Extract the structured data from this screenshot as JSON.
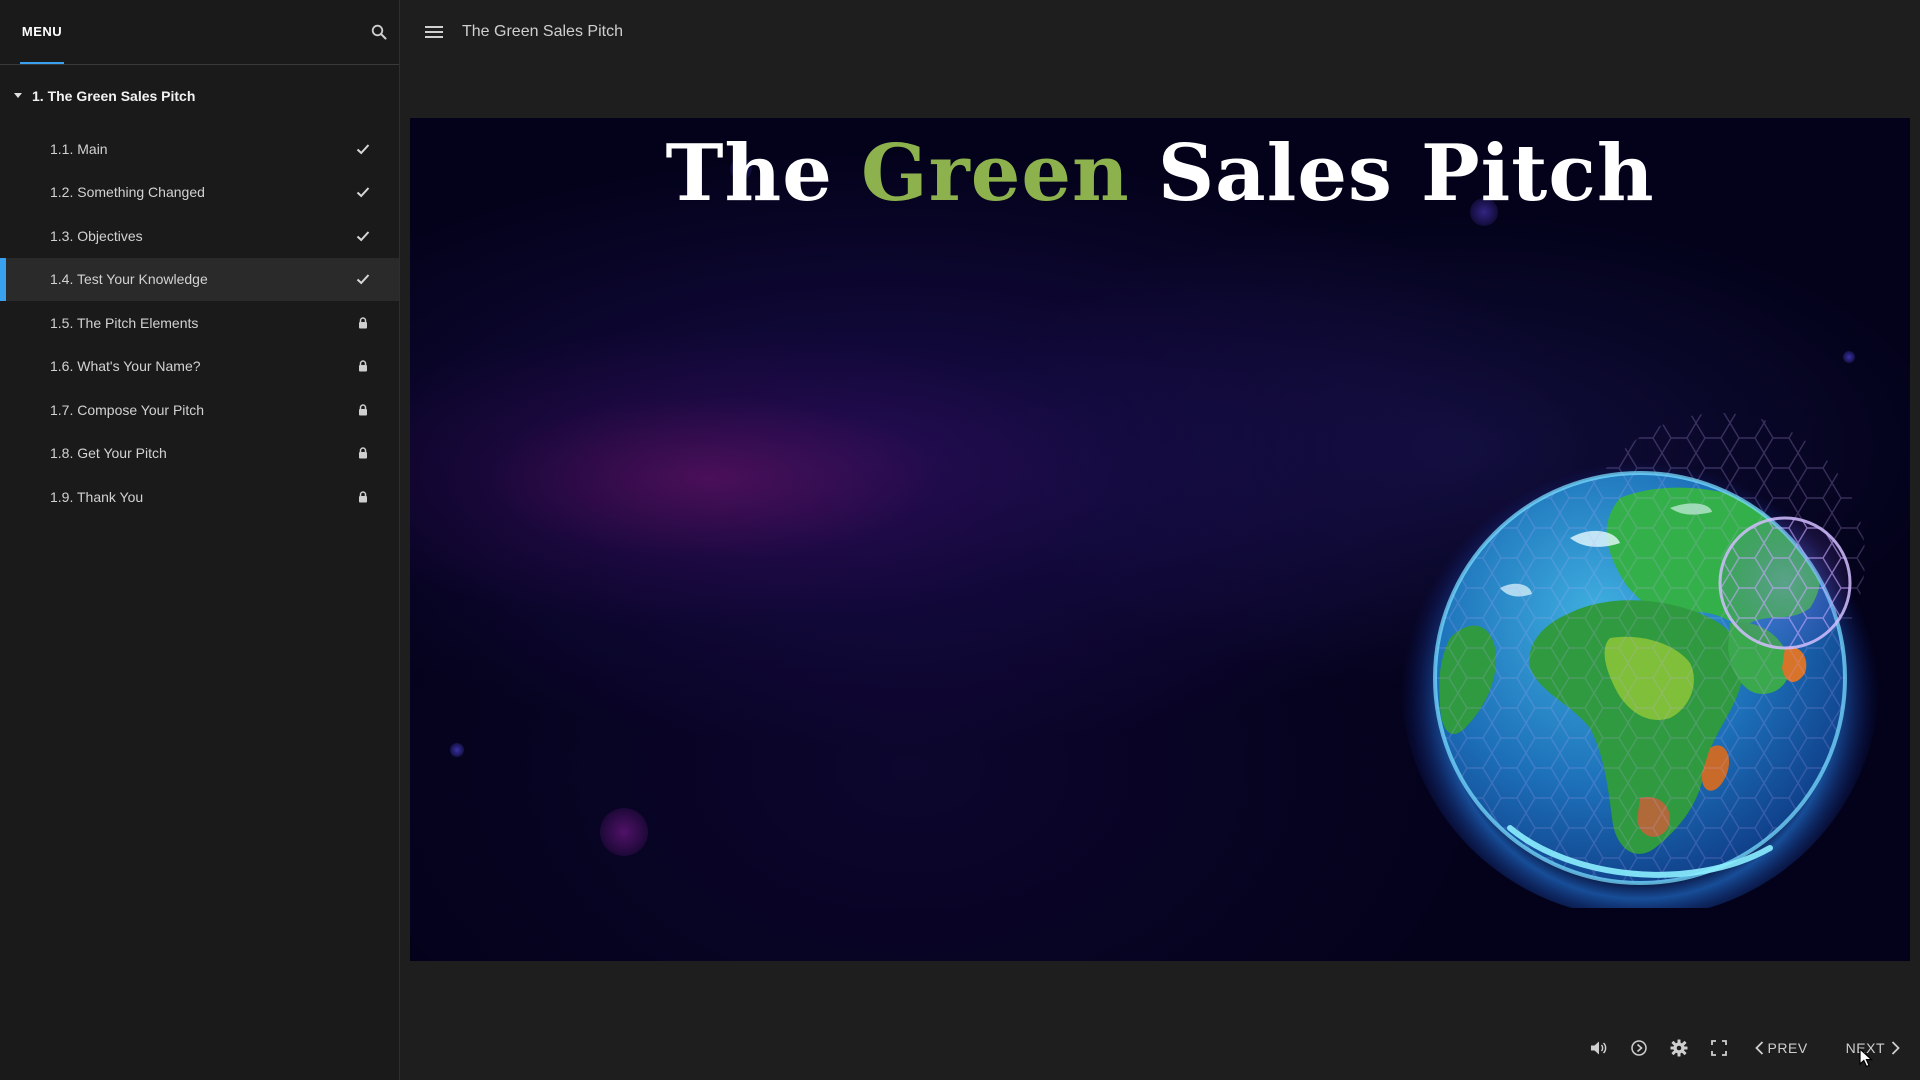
{
  "sidebar": {
    "menu_label": "MENU",
    "search_icon": "search-icon",
    "section": {
      "title": "1. The Green Sales Pitch",
      "expanded": true
    },
    "lessons": [
      {
        "label": "1.1. Main",
        "status": "complete"
      },
      {
        "label": "1.2. Something Changed",
        "status": "complete"
      },
      {
        "label": "1.3. Objectives",
        "status": "complete"
      },
      {
        "label": "1.4. Test Your Knowledge",
        "status": "complete",
        "active": true
      },
      {
        "label": "1.5. The Pitch Elements",
        "status": "locked"
      },
      {
        "label": "1.6. What's Your Name?",
        "status": "locked"
      },
      {
        "label": "1.7. Compose Your Pitch",
        "status": "locked"
      },
      {
        "label": "1.8. Get Your Pitch",
        "status": "locked"
      },
      {
        "label": "1.9. Thank You",
        "status": "locked"
      }
    ]
  },
  "topbar": {
    "menu_icon": "hamburger-icon",
    "course_title": "The Green Sales Pitch"
  },
  "slide": {
    "title_part1": "The",
    "title_accent": "Green",
    "title_part2": "Sales Pitch",
    "image": "earth-globe-with-hexagon-shield"
  },
  "controls": {
    "icons": [
      "volume-icon",
      "captions-icon",
      "settings-icon",
      "fullscreen-icon"
    ],
    "prev_label": "PREV",
    "next_label": "NEXT"
  },
  "colors": {
    "accent_blue": "#3aa0f0",
    "title_green": "#8db24d",
    "background": "#1e1e1e",
    "sidebar_bg": "#1a1a1a"
  }
}
